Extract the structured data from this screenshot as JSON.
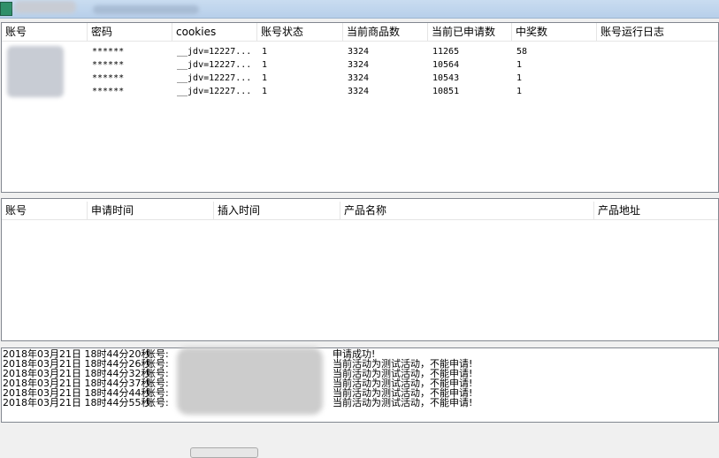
{
  "accounts_table": {
    "columns": [
      "账号",
      "密码",
      "cookies",
      "账号状态",
      "当前商品数",
      "当前已申请数",
      "中奖数",
      "账号运行日志"
    ],
    "rows": [
      {
        "password": "******",
        "cookies": "__jdv=12227...",
        "status": "1",
        "goods": "3324",
        "applied": "11265",
        "wins": "58"
      },
      {
        "password": "******",
        "cookies": "__jdv=12227...",
        "status": "1",
        "goods": "3324",
        "applied": "10564",
        "wins": "1"
      },
      {
        "password": "******",
        "cookies": "__jdv=12227...",
        "status": "1",
        "goods": "3324",
        "applied": "10543",
        "wins": "1"
      },
      {
        "password": "******",
        "cookies": "__jdv=12227...",
        "status": "1",
        "goods": "3324",
        "applied": "10851",
        "wins": "1"
      }
    ]
  },
  "applications_table": {
    "columns": [
      "账号",
      "申请时间",
      "插入时间",
      "产品名称",
      "产品地址"
    ]
  },
  "log": [
    {
      "time": "2018年03月21日 18时44分20秒",
      "label": "账号:",
      "msg": "申请成功!"
    },
    {
      "time": "2018年03月21日 18时44分26秒",
      "label": "账号:",
      "msg": "当前活动为测试活动，不能申请!"
    },
    {
      "time": "2018年03月21日 18时44分32秒",
      "label": "账号:",
      "msg": "当前活动为测试活动，不能申请!"
    },
    {
      "time": "2018年03月21日 18时44分37秒",
      "label": "账号:",
      "msg": "当前活动为测试活动，不能申请!"
    },
    {
      "time": "2018年03月21日 18时44分44秒",
      "label": "账号:",
      "msg": "当前活动为测试活动，不能申请!"
    },
    {
      "time": "2018年03月21日 18时44分55秒",
      "label": "账号:",
      "msg": "当前活动为测试活动，不能申请!"
    }
  ]
}
